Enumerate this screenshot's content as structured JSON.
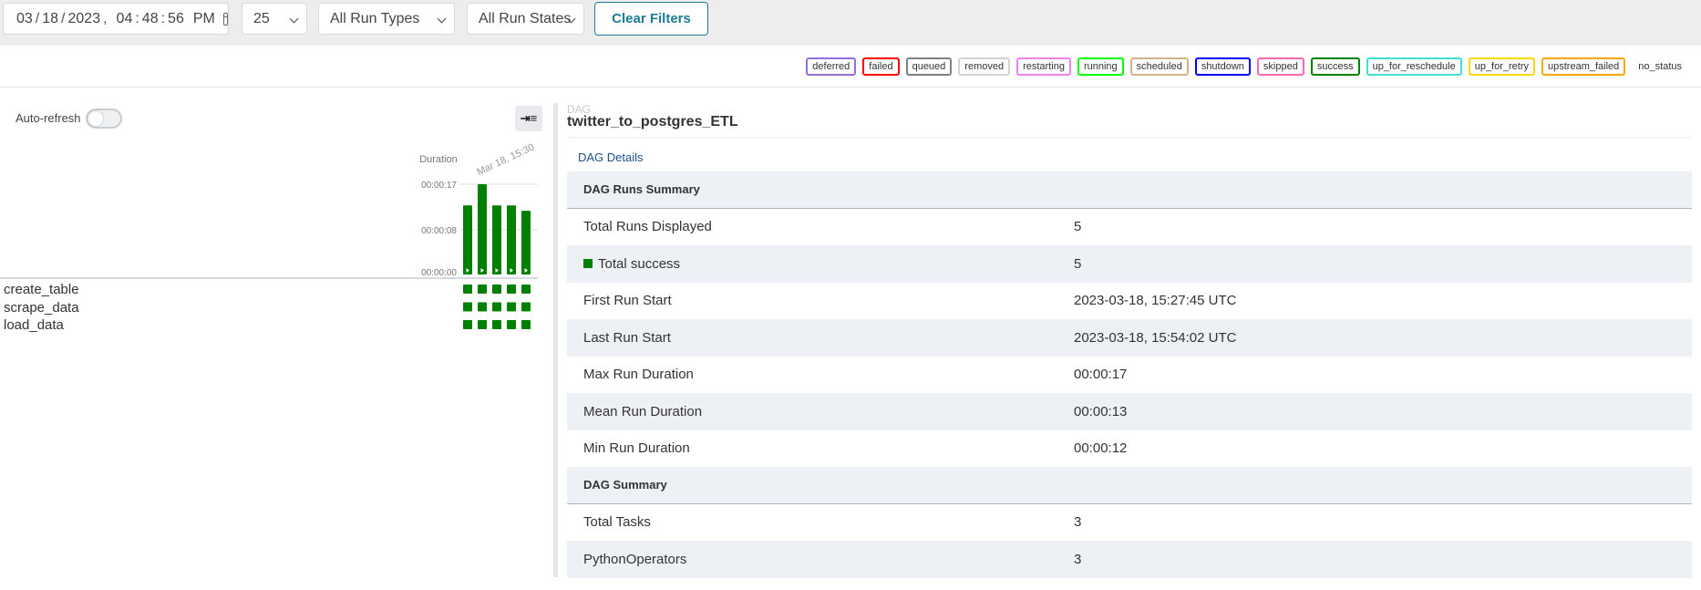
{
  "filters": {
    "date": {
      "month": "03",
      "day": "18",
      "year": "2023",
      "hour": "04",
      "minute": "48",
      "second": "56",
      "ampm": "PM"
    },
    "num_runs": "25",
    "run_type": "All Run Types",
    "run_state": "All Run States",
    "clear_label": "Clear Filters"
  },
  "legend": [
    {
      "label": "deferred",
      "color": "#9370db"
    },
    {
      "label": "failed",
      "color": "#ff0000"
    },
    {
      "label": "queued",
      "color": "#808080"
    },
    {
      "label": "removed",
      "color": "#d3d3d3"
    },
    {
      "label": "restarting",
      "color": "#ee82ee"
    },
    {
      "label": "running",
      "color": "#00ff00"
    },
    {
      "label": "scheduled",
      "color": "#d2b48c"
    },
    {
      "label": "shutdown",
      "color": "#0000ff"
    },
    {
      "label": "skipped",
      "color": "#ff69b4"
    },
    {
      "label": "success",
      "color": "#008000"
    },
    {
      "label": "up_for_reschedule",
      "color": "#40e0d0"
    },
    {
      "label": "up_for_retry",
      "color": "#ffd700"
    },
    {
      "label": "upstream_failed",
      "color": "#ffa500"
    },
    {
      "label": "no_status",
      "color": "transparent"
    }
  ],
  "left": {
    "autorefresh_label": "Auto-refresh",
    "duration_label": "Duration",
    "date_label": "Mar 18, 15:30",
    "y_ticks": [
      "00:00:17",
      "00:00:08",
      "00:00:00"
    ],
    "run_durations_sec": [
      13,
      17,
      13,
      13,
      12
    ],
    "run_color": "#008000",
    "tasks": [
      "create_table",
      "scrape_data",
      "load_data"
    ]
  },
  "dag": {
    "label": "DAG",
    "dag_id": "twitter_to_postgres_ETL",
    "details_tab": "DAG Details"
  },
  "table": [
    {
      "type": "header",
      "label": "DAG Runs Summary"
    },
    {
      "label": "Total Runs Displayed",
      "value": "5"
    },
    {
      "label": "Total success",
      "value": "5",
      "swatch": true
    },
    {
      "label": "First Run Start",
      "value": "2023-03-18, 15:27:45 UTC"
    },
    {
      "label": "Last Run Start",
      "value": "2023-03-18, 15:54:02 UTC"
    },
    {
      "label": "Max Run Duration",
      "value": "00:00:17"
    },
    {
      "label": "Mean Run Duration",
      "value": "00:00:13"
    },
    {
      "label": "Min Run Duration",
      "value": "00:00:12"
    },
    {
      "type": "header",
      "label": "DAG Summary"
    },
    {
      "label": "Total Tasks",
      "value": "3"
    },
    {
      "label": "PythonOperators",
      "value": "3"
    }
  ]
}
